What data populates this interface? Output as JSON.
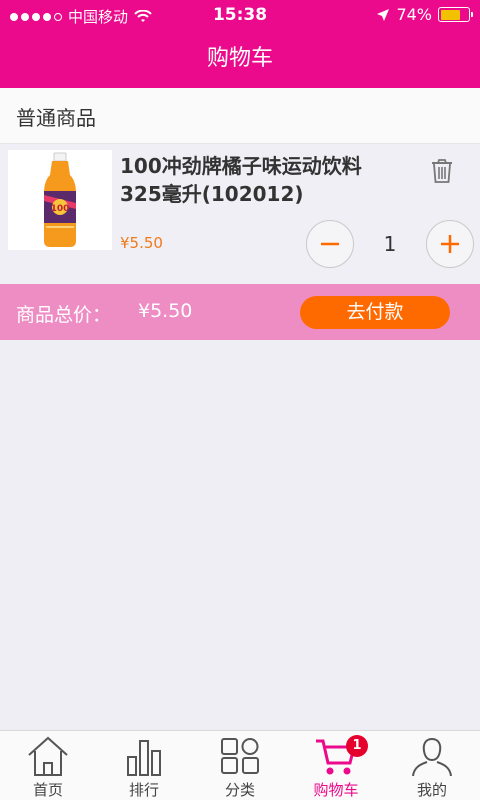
{
  "status_bar": {
    "carrier": "中国移动",
    "time": "15:38",
    "battery": "74%",
    "battery_level": 0.74
  },
  "header": {
    "title": "购物车"
  },
  "section": {
    "title": "普通商品"
  },
  "cart": {
    "items": [
      {
        "name_line1": "100冲劲牌橘子味运动饮料",
        "name_line2": "325毫升(102012)",
        "price": "¥5.50",
        "quantity": "1",
        "image_icon": "orange-drink-bottle-image"
      }
    ]
  },
  "summary": {
    "total_label": "商品总价：",
    "total_value": "¥5.50",
    "pay_label": "去付款"
  },
  "tabbar": {
    "tabs": [
      {
        "label": "首页",
        "icon": "home-icon"
      },
      {
        "label": "排行",
        "icon": "bar-chart-icon"
      },
      {
        "label": "分类",
        "icon": "grid-icon"
      },
      {
        "label": "购物车",
        "icon": "cart-icon",
        "active": true,
        "badge": "1"
      },
      {
        "label": "我的",
        "icon": "user-icon"
      }
    ]
  },
  "colors": {
    "brand": "#ec0a8c",
    "total_bar": "#ee8cc4",
    "pay_button": "#ff6a00",
    "qty_icon": "#ff6a00",
    "price": "#f07a1a",
    "badge": "#e5002d"
  }
}
